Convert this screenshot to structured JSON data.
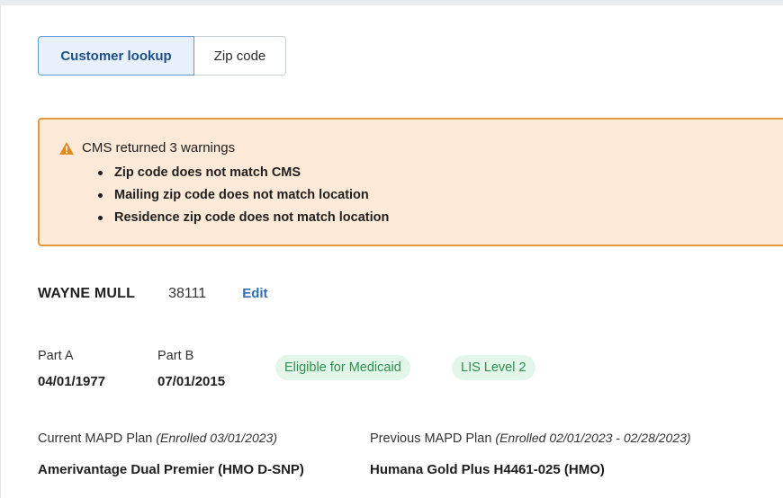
{
  "lookup_toggle": {
    "customer_lookup": "Customer lookup",
    "zip_code": "Zip code"
  },
  "warning": {
    "title": "CMS returned 3 warnings",
    "items": [
      "Zip code does not match CMS",
      "Mailing zip code does not match location",
      "Residence zip code does not match location"
    ]
  },
  "customer": {
    "name": "WAYNE MULL",
    "zip": "38111",
    "edit_label": "Edit"
  },
  "parts": {
    "part_a": {
      "label": "Part A",
      "date": "04/01/1977"
    },
    "part_b": {
      "label": "Part B",
      "date": "07/01/2015"
    }
  },
  "badges": {
    "medicaid": "Eligible for Medicaid",
    "lis": "LIS Level 2"
  },
  "plans": {
    "current": {
      "label": "Current MAPD Plan",
      "enrolled": "(Enrolled 03/01/2023)",
      "name": "Amerivantage Dual Premier (HMO D-SNP)"
    },
    "previous": {
      "label": "Previous MAPD Plan",
      "enrolled": "(Enrolled 02/01/2023 - 02/28/2023)",
      "name": "Humana Gold Plus H4461-025 (HMO)"
    }
  },
  "colors": {
    "warning_bg": "#fde9d7",
    "warning_border": "#e59a3b",
    "accent_blue": "#2f6fb4",
    "badge_green": "#2f8f4e"
  }
}
